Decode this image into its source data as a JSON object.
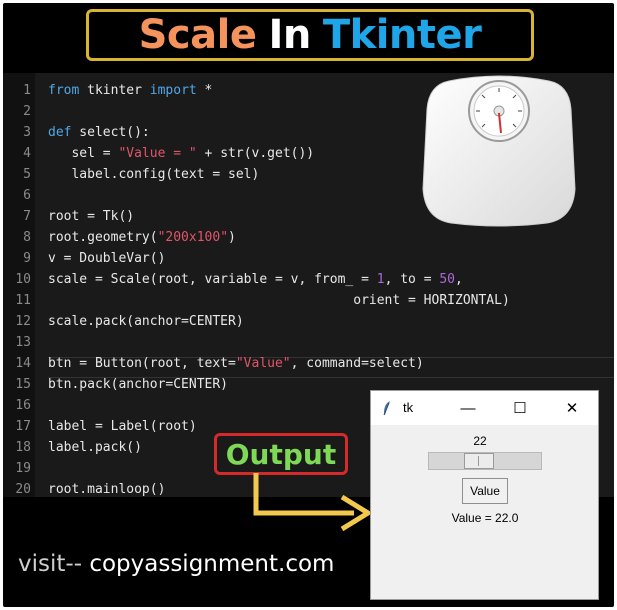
{
  "header": {
    "title_part1": "Scale",
    "title_part2": "In",
    "title_part3": "Tkinter",
    "colors": {
      "part1": "#f4935c",
      "part2": "#ffffff",
      "part3": "#1fa6e8",
      "border": "#d9b431"
    }
  },
  "code": {
    "lines": [
      {
        "n": "1",
        "text": "from tkinter import *"
      },
      {
        "n": "2",
        "text": ""
      },
      {
        "n": "3",
        "text": "def select():"
      },
      {
        "n": "4",
        "text": "   sel = \"Value = \" + str(v.get())"
      },
      {
        "n": "5",
        "text": "   label.config(text = sel)"
      },
      {
        "n": "6",
        "text": ""
      },
      {
        "n": "7",
        "text": "root = Tk()"
      },
      {
        "n": "8",
        "text": "root.geometry(\"200x100\")"
      },
      {
        "n": "9",
        "text": "v = DoubleVar()"
      },
      {
        "n": "10",
        "text": "scale = Scale(root, variable = v, from_ = 1, to = 50,"
      },
      {
        "n": "11",
        "text": "                                       orient = HORIZONTAL)"
      },
      {
        "n": "12",
        "text": "scale.pack(anchor=CENTER)"
      },
      {
        "n": "13",
        "text": ""
      },
      {
        "n": "14",
        "text": "btn = Button(root, text=\"Value\", command=select)"
      },
      {
        "n": "15",
        "text": "btn.pack(anchor=CENTER)"
      },
      {
        "n": "16",
        "text": ""
      },
      {
        "n": "17",
        "text": "label = Label(root)"
      },
      {
        "n": "18",
        "text": "label.pack()"
      },
      {
        "n": "19",
        "text": ""
      },
      {
        "n": "20",
        "text": "root.mainloop()"
      }
    ]
  },
  "output_label": "Output",
  "footer": {
    "visit_prefix": "visit--",
    "site": "copyassignment.com"
  },
  "tk_window": {
    "title": "tk",
    "minimize": "—",
    "maximize": "☐",
    "close": "✕",
    "scale_value": "22",
    "scale_fraction": 0.43,
    "button_label": "Value",
    "result_text": "Value = 22.0"
  },
  "icons": [
    "feather-icon",
    "bathroom-scale-image",
    "arrow-icon"
  ]
}
